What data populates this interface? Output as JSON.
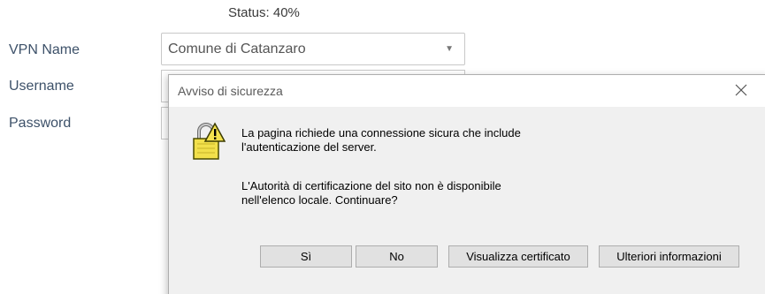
{
  "status": {
    "text": "Status: 40%"
  },
  "form": {
    "vpn_label": "VPN Name",
    "vpn_value": "Comune di Catanzaro",
    "username_label": "Username",
    "password_label": "Password"
  },
  "dialog": {
    "title": "Avviso di sicurezza",
    "message1_line1": "La pagina richiede una connessione sicura che include",
    "message1_line2": "l'autenticazione del server.",
    "message2_line1": "L'Autorità di certificazione del sito non è disponibile",
    "message2_line2": "nell'elenco locale. Continuare?",
    "buttons": {
      "yes": "Sì",
      "no": "No",
      "view_certificate": "Visualizza certificato",
      "more_info": "Ulteriori informazioni"
    }
  },
  "icons": {
    "dialog": "padlock-warning-icon",
    "close": "close-icon",
    "dropdown": "chevron-down-icon"
  },
  "colors": {
    "label_text": "#3d5169",
    "dialog_bg": "#f0f0f0",
    "lock_yellow": "#f2e04b"
  }
}
